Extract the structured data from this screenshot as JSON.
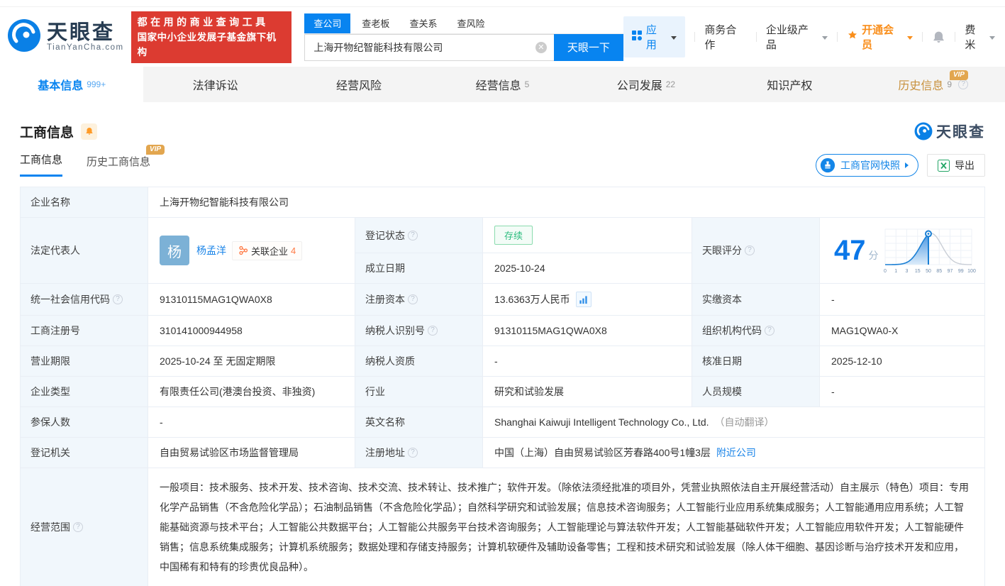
{
  "brand": {
    "name": "天眼查",
    "domain": "TianYanCha.com",
    "slogan_line1": "都在用的商业查询工具",
    "slogan_line2": "国家中小企业发展子基金旗下机构"
  },
  "search": {
    "tabs": [
      {
        "label": "查公司"
      },
      {
        "label": "查老板"
      },
      {
        "label": "查关系"
      },
      {
        "label": "查风险"
      }
    ],
    "value": "上海开物纪智能科技有限公司",
    "button": "天眼一下"
  },
  "top_nav": {
    "apps": "应用",
    "cooperation": "商务合作",
    "enterprise": "企业级产品",
    "vip": "开通会员",
    "user": "费米"
  },
  "main_tabs": [
    {
      "label": "基本信息",
      "count": "999+"
    },
    {
      "label": "法律诉讼",
      "count": ""
    },
    {
      "label": "经营风险",
      "count": ""
    },
    {
      "label": "经营信息",
      "count": "5"
    },
    {
      "label": "公司发展",
      "count": "22"
    },
    {
      "label": "知识产权",
      "count": ""
    },
    {
      "label": "历史信息",
      "count": "9",
      "badge": "VIP"
    }
  ],
  "section": {
    "title": "工商信息",
    "watermark": "天眼查",
    "subtabs": [
      {
        "label": "工商信息"
      },
      {
        "label": "历史工商信息",
        "badge": "VIP"
      }
    ],
    "snapshot_button": "工商官网快照",
    "export_button": "导出"
  },
  "table": {
    "company_name": {
      "label": "企业名称",
      "value": "上海开物纪智能科技有限公司"
    },
    "legal_rep": {
      "label": "法定代表人",
      "name": "杨孟洋",
      "avatar": "杨",
      "related_label": "关联企业",
      "related_count": "4"
    },
    "reg_status": {
      "label": "登记状态",
      "value": "存续"
    },
    "establish_date": {
      "label": "成立日期",
      "value": "2025-10-24"
    },
    "score": {
      "label": "天眼评分",
      "value": "47",
      "unit": "分"
    },
    "credit_code": {
      "label": "统一社会信用代码",
      "value": "91310115MAG1QWA0X8"
    },
    "reg_capital": {
      "label": "注册资本",
      "value": "13.6363万人民币"
    },
    "paid_capital": {
      "label": "实缴资本",
      "value": "-"
    },
    "reg_number": {
      "label": "工商注册号",
      "value": "310141000944958"
    },
    "taxpayer_id": {
      "label": "纳税人识别号",
      "value": "91310115MAG1QWA0X8"
    },
    "org_code": {
      "label": "组织机构代码",
      "value": "MAG1QWA0-X"
    },
    "business_term": {
      "label": "营业期限",
      "value": "2025-10-24 至 无固定期限"
    },
    "taxpayer_qualification": {
      "label": "纳税人资质",
      "value": "-"
    },
    "approval_date": {
      "label": "核准日期",
      "value": "2025-12-10"
    },
    "company_type": {
      "label": "企业类型",
      "value": "有限责任公司(港澳台投资、非独资)"
    },
    "industry": {
      "label": "行业",
      "value": "研究和试验发展"
    },
    "staff_size": {
      "label": "人员规模",
      "value": "-"
    },
    "insured_count": {
      "label": "参保人数",
      "value": "-"
    },
    "english_name": {
      "label": "英文名称",
      "value": "Shanghai Kaiwuji Intelligent Technology Co., Ltd.",
      "note": "（自动翻译）"
    },
    "reg_authority": {
      "label": "登记机关",
      "value": "自由贸易试验区市场监督管理局"
    },
    "reg_address": {
      "label": "注册地址",
      "value": "中国（上海）自由贸易试验区芳春路400号1幢3层",
      "link": "附近公司"
    },
    "business_scope": {
      "label": "经营范围",
      "value": "一般项目：技术服务、技术开发、技术咨询、技术交流、技术转让、技术推广；软件开发。（除依法须经批准的项目外，凭营业执照依法自主开展经营活动）自主展示（特色）项目：专用化学产品销售（不含危险化学品）；石油制品销售（不含危险化学品）；自然科学研究和试验发展；信息技术咨询服务；人工智能行业应用系统集成服务；人工智能通用应用系统；人工智能基础资源与技术平台；人工智能公共数据平台；人工智能公共服务平台技术咨询服务；人工智能理论与算法软件开发；人工智能基础软件开发；人工智能应用软件开发；人工智能硬件销售；信息系统集成服务；计算机系统服务；数据处理和存储支持服务；计算机软硬件及辅助设备零售；工程和技术研究和试验发展（除人体干细胞、基因诊断与治疗技术开发和应用，中国稀有和特有的珍贵优良品种）。"
    }
  },
  "chart_data": {
    "type": "area",
    "title": "天眼评分",
    "score": 47,
    "unit": "分",
    "x_ticks": [
      "0",
      "1",
      "3",
      "15",
      "50",
      "85",
      "97",
      "99",
      "100"
    ],
    "marker_at_tick": "50",
    "grid": true,
    "colors": {
      "filled_curve": "#1a7fd4",
      "rest_curve": "#c9ced6",
      "fill_top": "#4a97e2",
      "fill_bottom": "#dcecfa"
    }
  }
}
